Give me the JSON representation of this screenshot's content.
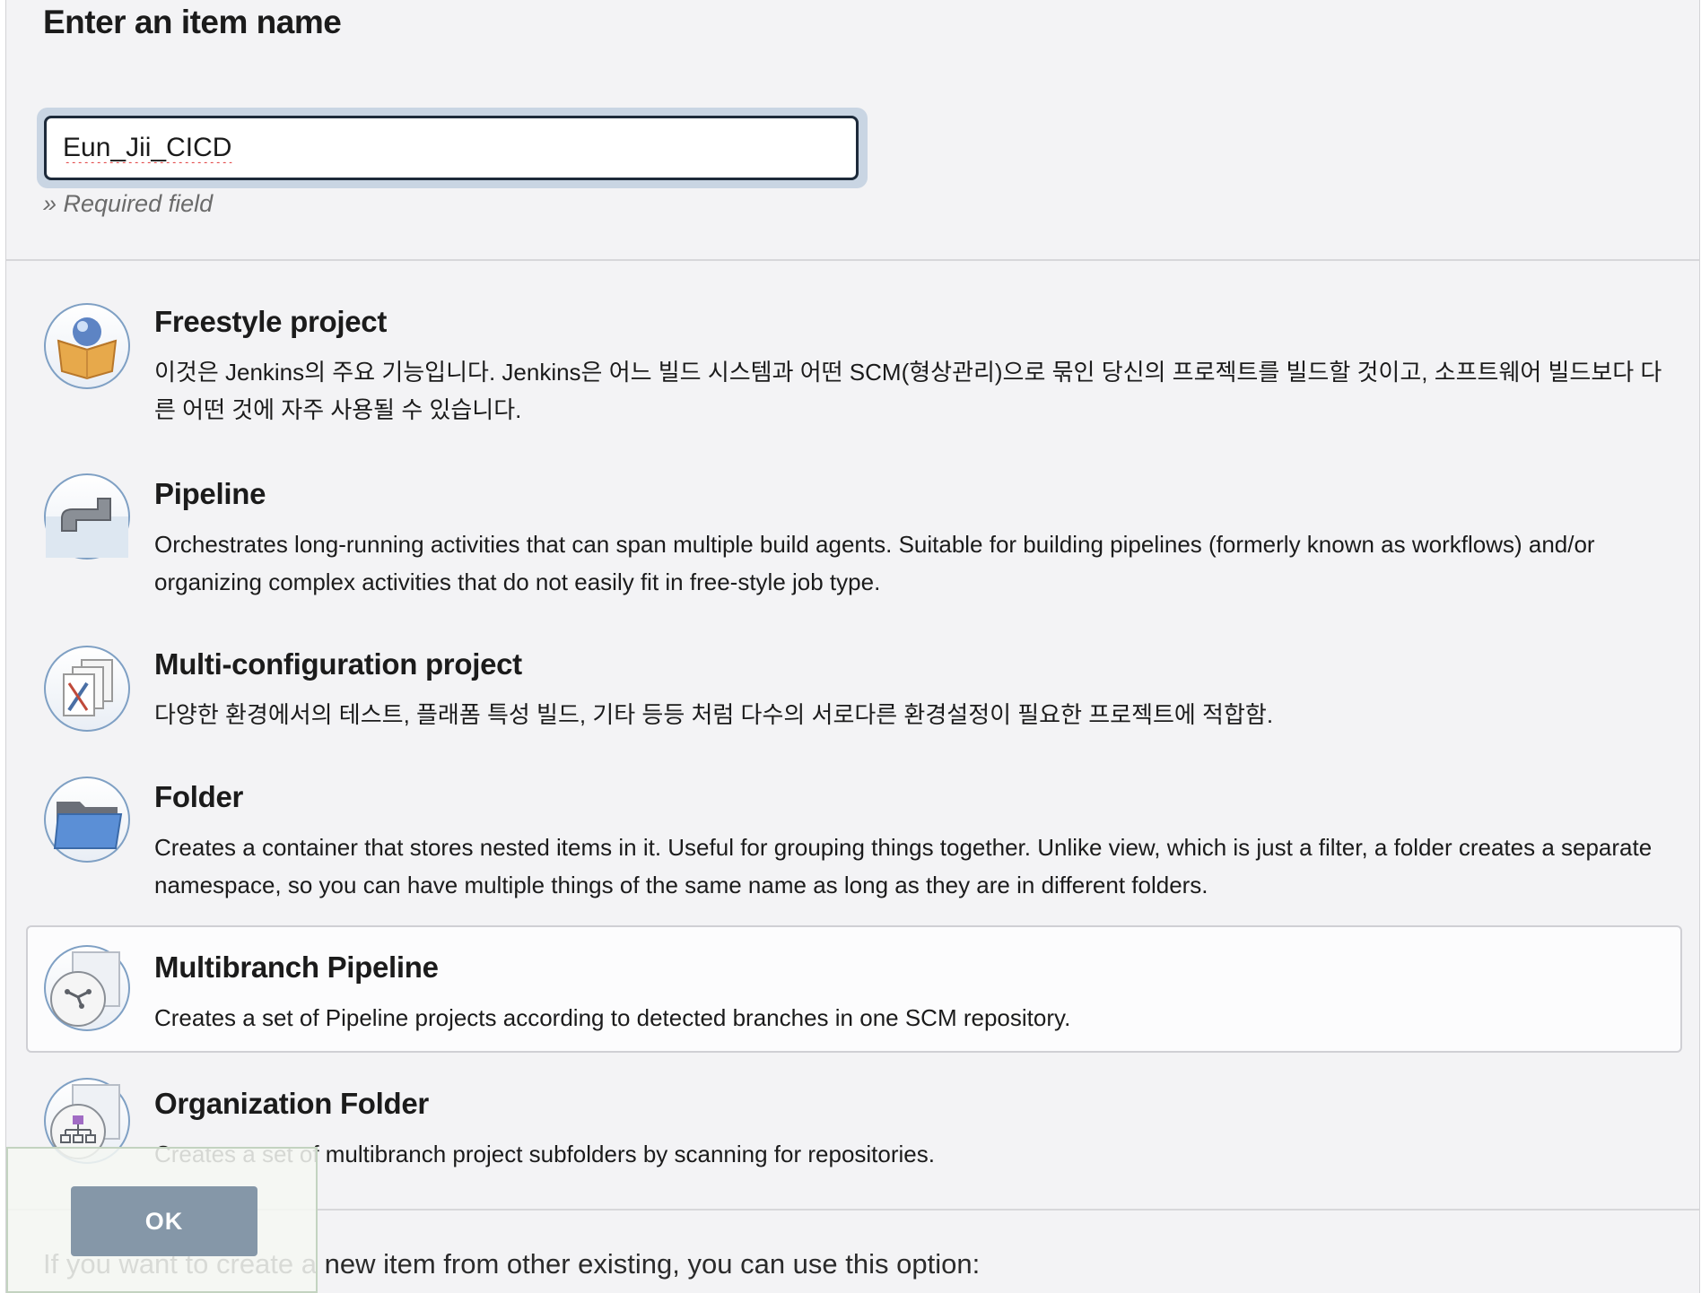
{
  "form": {
    "title": "Enter an item name",
    "name_value": "Eun_Jii_CICD",
    "required_text": "» Required field"
  },
  "items": [
    {
      "name": "Freestyle project",
      "description": "이것은 Jenkins의 주요 기능입니다. Jenkins은 어느 빌드 시스템과 어떤 SCM(형상관리)으로 묶인 당신의 프로젝트를 빌드할 것이고, 소프트웨어 빌드보다 다른 어떤 것에 자주 사용될 수 있습니다.",
      "icon": "freestyle-box-icon"
    },
    {
      "name": "Pipeline",
      "description": "Orchestrates long-running activities that can span multiple build agents. Suitable for building pipelines (formerly known as workflows) and/or organizing complex activities that do not easily fit in free-style job type.",
      "icon": "pipe-icon"
    },
    {
      "name": "Multi-configuration project",
      "description": "다양한 환경에서의 테스트, 플래폼 특성 빌드, 기타 등등 처럼 다수의 서로다른 환경설정이 필요한 프로젝트에 적합함.",
      "icon": "multi-config-icon"
    },
    {
      "name": "Folder",
      "description": "Creates a container that stores nested items in it. Useful for grouping things together. Unlike view, which is just a filter, a folder creates a separate namespace, so you can have multiple things of the same name as long as they are in different folders.",
      "icon": "folder-icon"
    },
    {
      "name": "Multibranch Pipeline",
      "description": "Creates a set of Pipeline projects according to detected branches in one SCM repository.",
      "icon": "multibranch-icon",
      "selected": true
    },
    {
      "name": "Organization Folder",
      "description": "Creates a set of multibranch project subfolders by scanning for repositories.",
      "icon": "organization-folder-icon"
    }
  ],
  "copy_hint": "If you want to create a new item from other existing, you can use this option:",
  "ok_label": "OK",
  "colors": {
    "page_bg": "#f3f3f5",
    "input_border": "#1d2a3a",
    "focus_ring": "#c9d5e3",
    "ok_button": "#8597a8"
  }
}
